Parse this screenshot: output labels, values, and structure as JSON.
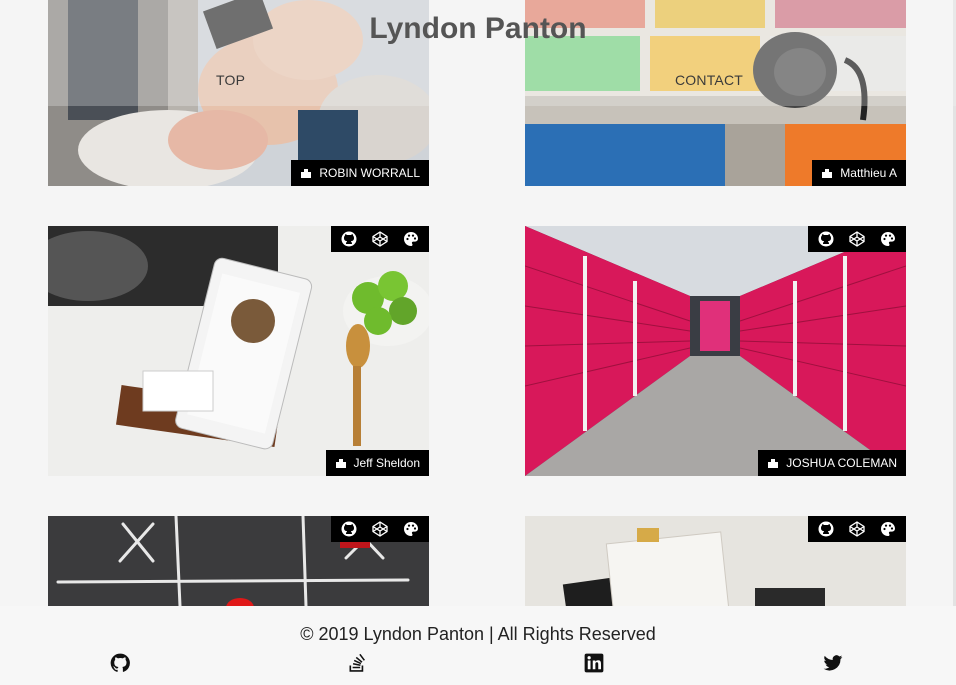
{
  "header": {
    "title": "Lyndon Panton",
    "nav": [
      {
        "label": "TOP"
      },
      {
        "label": "CONTACT"
      }
    ]
  },
  "cards": [
    {
      "credit": "ROBIN WORRALL",
      "icons": []
    },
    {
      "credit": "Matthieu A",
      "icons": []
    },
    {
      "credit": "Jeff Sheldon",
      "icons": [
        "github-icon",
        "codepen-icon",
        "palette-icon"
      ]
    },
    {
      "credit": "JOSHUA COLEMAN",
      "icons": [
        "github-icon",
        "codepen-icon",
        "palette-icon"
      ]
    },
    {
      "credit": "",
      "icons": [
        "github-icon",
        "codepen-icon",
        "palette-icon"
      ]
    },
    {
      "credit": "",
      "icons": [
        "github-icon",
        "codepen-icon",
        "palette-icon"
      ]
    }
  ],
  "footer": {
    "copyright": "© 2019 Lyndon Panton | All Rights Reserved",
    "social": [
      "github-icon",
      "stackoverflow-icon",
      "linkedin-icon",
      "twitter-icon"
    ]
  },
  "colors": {
    "background": "#f5f5f5",
    "credit_bg": "#000000",
    "storage_red": "#d8185a"
  }
}
